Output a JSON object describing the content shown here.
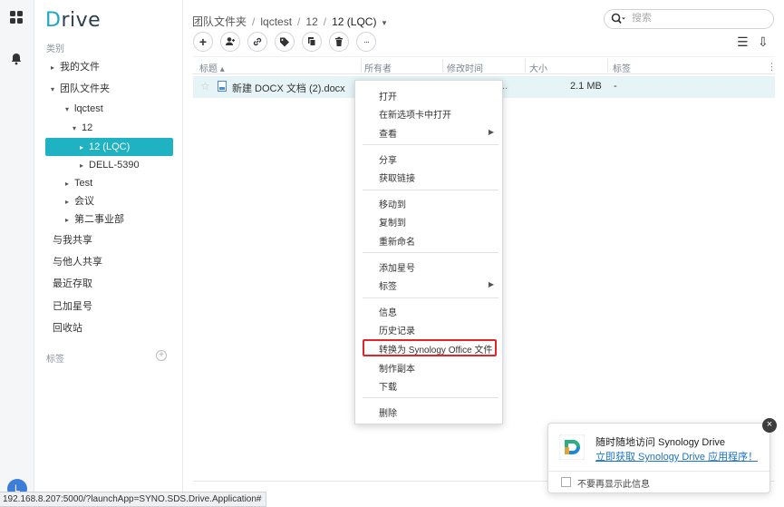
{
  "app": {
    "logo_prefix": "D",
    "logo_rest": "rive"
  },
  "rail": {
    "avatar_initial": "L"
  },
  "sidebar": {
    "categories_title": "类别",
    "tree": [
      {
        "label": "我的文件",
        "caret": "▸"
      },
      {
        "label": "团队文件夹",
        "caret": "▾"
      },
      {
        "label": "lqctest",
        "caret": "▾"
      },
      {
        "label": "12",
        "caret": "▾"
      },
      {
        "label": "12 (LQC)",
        "caret": "▸"
      },
      {
        "label": "DELL-5390",
        "caret": "▸"
      },
      {
        "label": "Test",
        "caret": "▸"
      },
      {
        "label": "会议",
        "caret": "▸"
      },
      {
        "label": "第二事业部",
        "caret": "▸"
      }
    ],
    "nav": [
      {
        "label": "与我共享"
      },
      {
        "label": "与他人共享"
      },
      {
        "label": "最近存取"
      },
      {
        "label": "已加星号"
      },
      {
        "label": "回收站"
      }
    ],
    "tags_title": "标签"
  },
  "breadcrumb": {
    "items": [
      "团队文件夹",
      "lqctest",
      "12"
    ],
    "separator": "/",
    "current": "12 (LQC)",
    "dropdown": "▾"
  },
  "search": {
    "placeholder": "搜索",
    "icon": "search-icon"
  },
  "toolbar": {
    "buttons": [
      {
        "icon": "plus-icon",
        "glyph": "+"
      },
      {
        "icon": "add-user-icon",
        "glyph": "👤"
      },
      {
        "icon": "link-icon",
        "glyph": "🔗"
      },
      {
        "icon": "tag-icon",
        "glyph": "🏷"
      },
      {
        "icon": "copy-icon",
        "glyph": "⧉"
      },
      {
        "icon": "trash-icon",
        "glyph": "🗑"
      },
      {
        "icon": "more-icon",
        "glyph": "···"
      }
    ],
    "list_view_glyph": "☰",
    "sort_glyph": "⇩"
  },
  "table": {
    "columns": [
      "标题 ▴",
      "所有者",
      "修改时间",
      "大小",
      "标签"
    ],
    "more_glyph": "⋮",
    "rows": [
      {
        "star": "☆",
        "name": "新建 DOCX 文档 (2).docx",
        "modified": "...",
        "size": "2.1 MB",
        "tag": "-"
      }
    ]
  },
  "context_menu": {
    "groups": [
      [
        {
          "label": "打开"
        },
        {
          "label": "在新选项卡中打开"
        },
        {
          "label": "查看",
          "submenu": true
        }
      ],
      [
        {
          "label": "分享"
        },
        {
          "label": "获取链接"
        }
      ],
      [
        {
          "label": "移动到"
        },
        {
          "label": "复制到"
        },
        {
          "label": "重新命名"
        }
      ],
      [
        {
          "label": "添加星号"
        },
        {
          "label": "标签",
          "submenu": true
        }
      ],
      [
        {
          "label": "信息"
        },
        {
          "label": "历史记录"
        },
        {
          "label": "转换为 Synology Office 文件",
          "highlighted": true
        },
        {
          "label": "制作副本"
        },
        {
          "label": "下载"
        }
      ],
      [
        {
          "label": "删除"
        }
      ]
    ],
    "highlight_color": "#e0262a"
  },
  "promo": {
    "title": "随时随地访问 Synology Drive",
    "link": "立即获取 Synology Drive 应用程序！",
    "checkbox_label": "不要再显示此信息",
    "close_glyph": "×"
  },
  "statusbar": {
    "url": "192.168.8.207:5000/?launchApp=SYNO.SDS.Drive.Application#"
  },
  "colors": {
    "accent": "#1fb2c2",
    "row_selected": "#e6f4f7",
    "link": "#1a73c9"
  }
}
